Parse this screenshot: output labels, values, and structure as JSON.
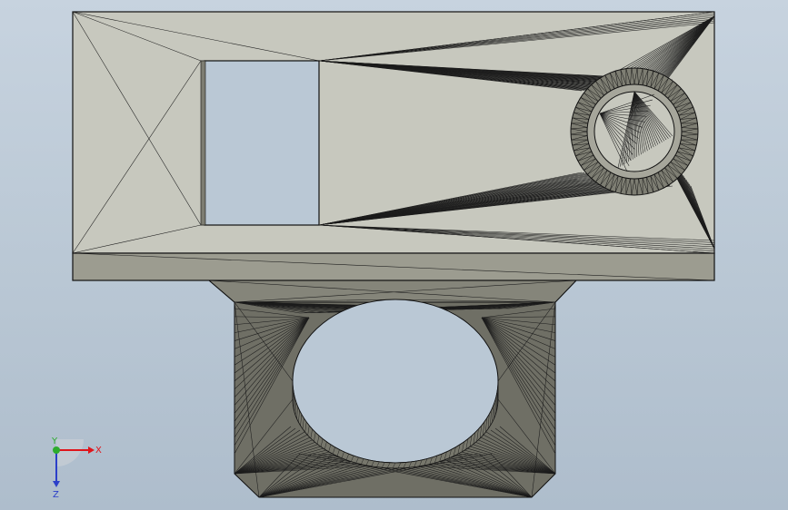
{
  "triad": {
    "x_label": "X",
    "y_label": "Y",
    "z_label": "Z"
  },
  "colors": {
    "background_top": "#c7d3df",
    "background_bottom": "#aebdcc",
    "face_light": "#c5c6bc",
    "face_mid": "#8b8b80",
    "face_dark": "#6d6d63",
    "edge": "#1a1a1a",
    "axis_x": "#e0151b",
    "axis_y": "#2dac2d",
    "axis_z": "#2b3fc9"
  }
}
